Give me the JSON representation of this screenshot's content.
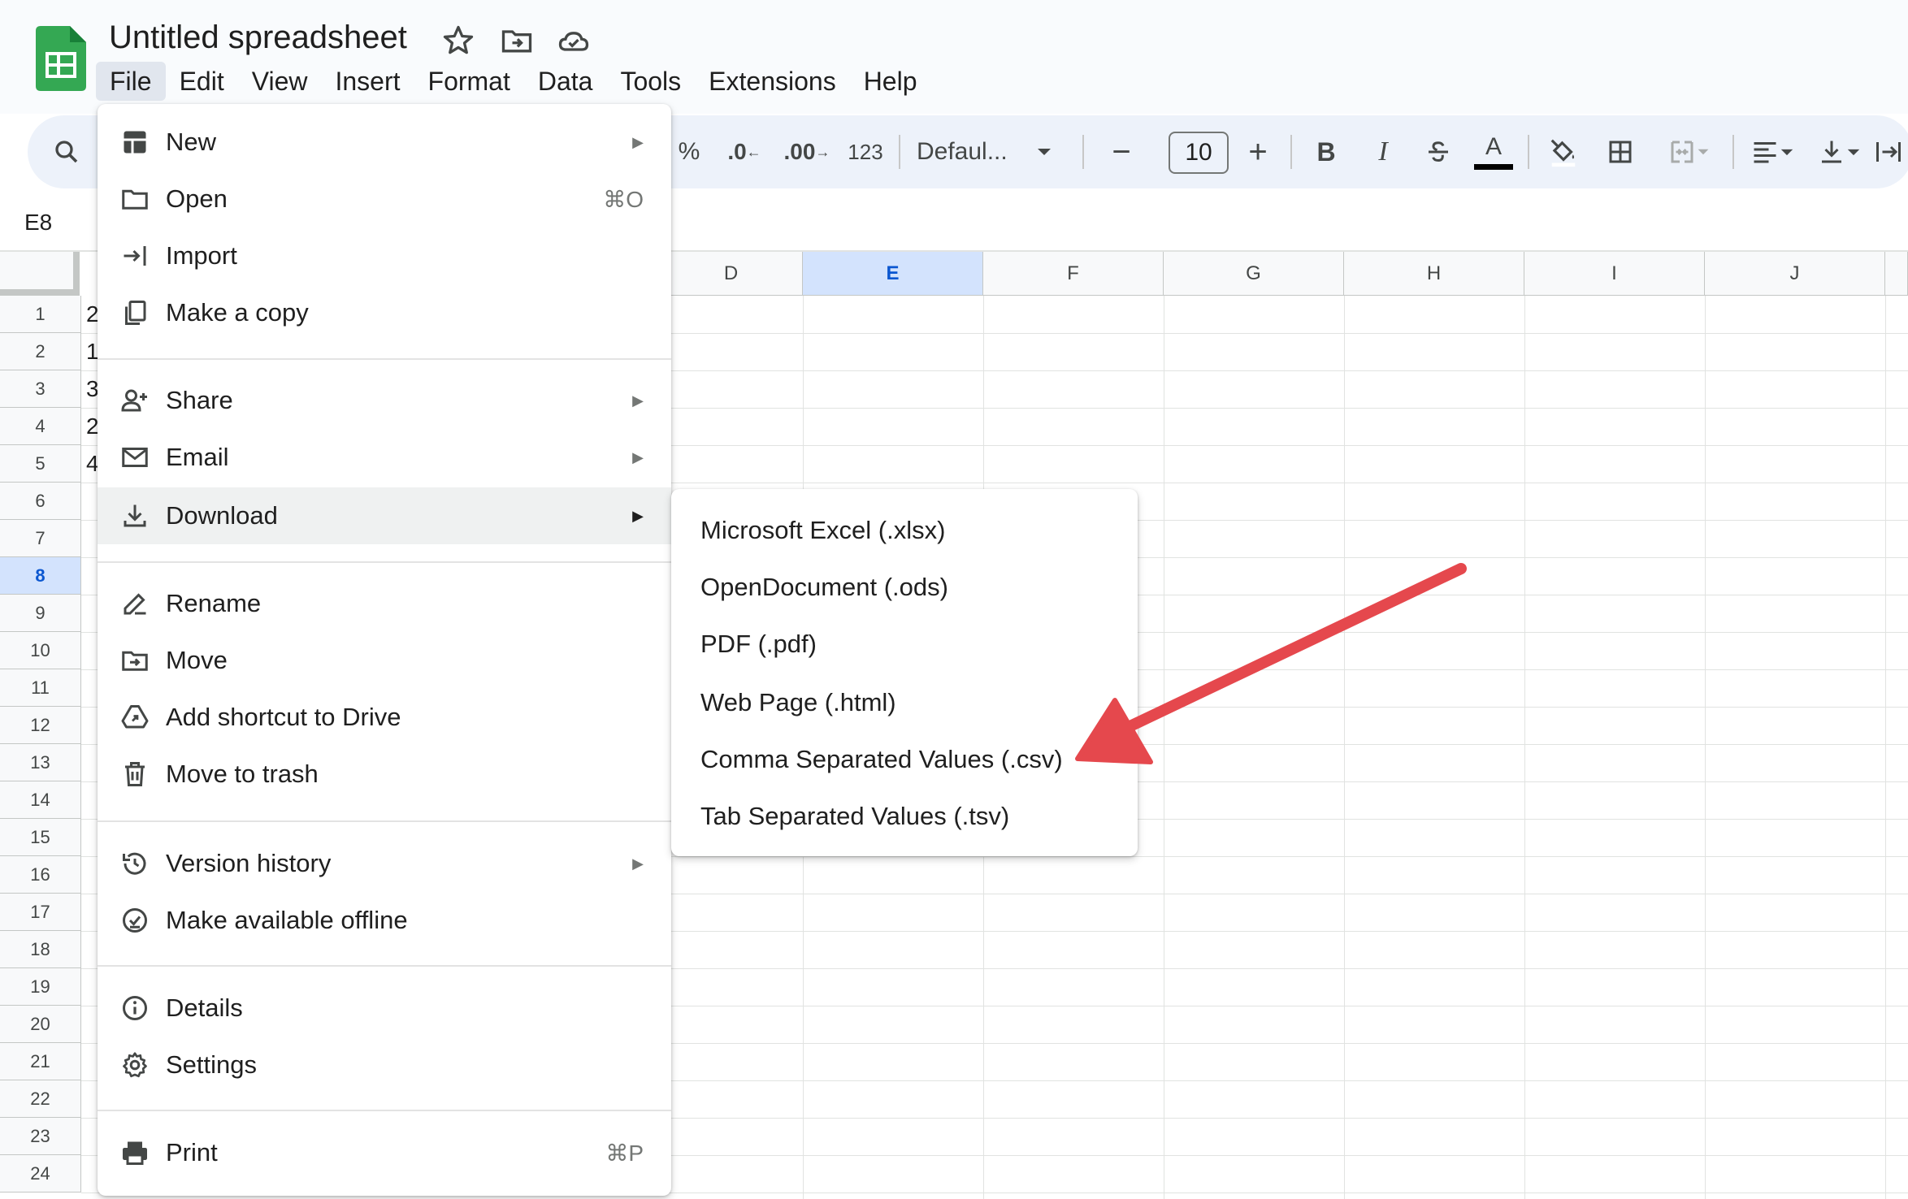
{
  "header": {
    "title": "Untitled spreadsheet",
    "menus": [
      "File",
      "Edit",
      "View",
      "Insert",
      "Format",
      "Data",
      "Tools",
      "Extensions",
      "Help"
    ],
    "active_menu": "File",
    "icons": [
      "sheets-logo-icon",
      "star-icon",
      "move-folder-icon",
      "cloud-saved-icon"
    ]
  },
  "toolbar": {
    "percent": "%",
    "decrease_decimal": ".0",
    "increase_decimal": ".00",
    "number_format": "123",
    "font_name": "Defaul...",
    "font_size": "10",
    "minus": "−",
    "plus": "+",
    "bold": "B",
    "italic": "I",
    "text_color_letter": "A"
  },
  "formula_bar": {
    "name_box": "E8"
  },
  "grid": {
    "columns": [
      "D",
      "E",
      "F",
      "G",
      "H",
      "I",
      "J"
    ],
    "selected_column": "E",
    "rows": [
      "1",
      "2",
      "3",
      "4",
      "5",
      "6",
      "7",
      "8",
      "9",
      "10",
      "11",
      "12",
      "13",
      "14",
      "15",
      "16",
      "17",
      "18",
      "19",
      "20",
      "21",
      "22",
      "23",
      "24"
    ],
    "selected_row": "8",
    "column_a_partial_values": [
      "2",
      "1",
      "3",
      "2",
      "4"
    ]
  },
  "file_menu": {
    "items": [
      {
        "label": "New",
        "icon": "new-sheet-icon",
        "submenu": true
      },
      {
        "label": "Open",
        "icon": "folder-icon",
        "shortcut": "⌘O"
      },
      {
        "label": "Import",
        "icon": "import-icon"
      },
      {
        "label": "Make a copy",
        "icon": "copy-icon"
      },
      {
        "label": "Share",
        "icon": "share-person-icon",
        "submenu": true
      },
      {
        "label": "Email",
        "icon": "email-icon",
        "submenu": true
      },
      {
        "label": "Download",
        "icon": "download-icon",
        "submenu": true,
        "highlighted": true
      },
      {
        "label": "Rename",
        "icon": "rename-icon"
      },
      {
        "label": "Move",
        "icon": "move-folder-icon"
      },
      {
        "label": "Add shortcut to Drive",
        "icon": "drive-shortcut-icon"
      },
      {
        "label": "Move to trash",
        "icon": "trash-icon"
      },
      {
        "label": "Version history",
        "icon": "history-icon",
        "submenu": true
      },
      {
        "label": "Make available offline",
        "icon": "offline-icon"
      },
      {
        "label": "Details",
        "icon": "info-icon"
      },
      {
        "label": "Settings",
        "icon": "gear-icon"
      },
      {
        "label": "Print",
        "icon": "print-icon",
        "shortcut": "⌘P"
      }
    ],
    "submenu_arrow": "▶"
  },
  "download_menu": {
    "items": [
      "Microsoft Excel (.xlsx)",
      "OpenDocument (.ods)",
      "PDF (.pdf)",
      "Web Page (.html)",
      "Comma Separated Values (.csv)",
      "Tab Separated Values (.tsv)"
    ]
  },
  "colors": {
    "annotation_arrow": "#e5484d",
    "selection_blue": "#d3e3fd",
    "sheets_green": "#34a853",
    "menu_highlight": "#eff1f1"
  }
}
